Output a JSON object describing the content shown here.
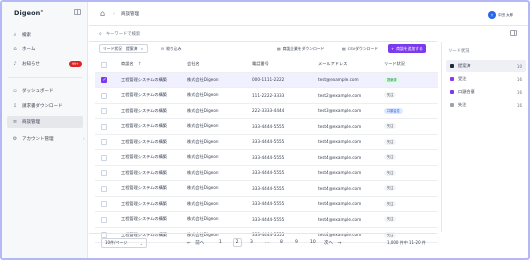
{
  "app": {
    "logo": "Digeon",
    "logo_mark": "®"
  },
  "sidebar": {
    "items": [
      {
        "icon": "search-icon",
        "label": "検索"
      },
      {
        "icon": "home-icon",
        "label": "ホーム"
      },
      {
        "icon": "bell-icon",
        "label": "お知らせ",
        "badge": "99+"
      },
      {
        "icon": "dashboard-icon",
        "label": "ダッシュボード"
      },
      {
        "icon": "download-icon",
        "label": "請求書ダウンロード"
      },
      {
        "icon": "list-icon",
        "label": "商談管理"
      },
      {
        "icon": "gear-icon",
        "label": "アカウント管理"
      }
    ]
  },
  "header": {
    "breadcrumb": "商談管理",
    "avatar_initials": "大",
    "username": "中田 太郎"
  },
  "search": {
    "placeholder": "キーワードで検索"
  },
  "toolbar": {
    "filter_chip_label": "リード状況",
    "filter_chip_value": "提案済",
    "filter_add_label": "絞り込み",
    "download_label": "商談企業をダウンロード",
    "csv_label": "CSVダウンロード",
    "add_label": "商談を追加する"
  },
  "table": {
    "columns": [
      "商談名",
      "会社名",
      "電話番号",
      "メールアドレス",
      "リード状況"
    ],
    "rows": [
      {
        "name": "工程管理システムの構築",
        "company": "株式会社Digeon",
        "phone": "000-1111-2222",
        "email": "test@example.com",
        "status": "提案済",
        "status_key": "proposed",
        "checked": true
      },
      {
        "name": "工程管理システムの構築",
        "company": "株式会社Digeon",
        "phone": "111-2222-3333",
        "email": "test2@example.com",
        "status": "失注",
        "status_key": "lost",
        "checked": false
      },
      {
        "name": "工程管理システムの構築",
        "company": "株式会社Digeon",
        "phone": "222-3333-4444",
        "email": "test3@example.com",
        "status": "口頭合意",
        "status_key": "verbal",
        "checked": false
      },
      {
        "name": "工程管理システムの構築",
        "company": "株式会社Digeon",
        "phone": "333-4444-5555",
        "email": "test4@example.com",
        "status": "失注",
        "status_key": "lost",
        "checked": false
      },
      {
        "name": "工程管理システムの構築",
        "company": "株式会社Digeon",
        "phone": "333-4444-5555",
        "email": "test4@example.com",
        "status": "失注",
        "status_key": "lost",
        "checked": false
      },
      {
        "name": "工程管理システムの構築",
        "company": "株式会社Digeon",
        "phone": "333-4444-5555",
        "email": "test4@example.com",
        "status": "失注",
        "status_key": "lost",
        "checked": false
      },
      {
        "name": "工程管理システムの構築",
        "company": "株式会社Digeon",
        "phone": "333-4444-5555",
        "email": "test4@example.com",
        "status": "失注",
        "status_key": "lost",
        "checked": false
      },
      {
        "name": "工程管理システムの構築",
        "company": "株式会社Digeon",
        "phone": "333-4444-5555",
        "email": "test4@example.com",
        "status": "失注",
        "status_key": "lost",
        "checked": false
      },
      {
        "name": "工程管理システムの構築",
        "company": "株式会社Digeon",
        "phone": "333-4444-5555",
        "email": "test4@example.com",
        "status": "失注",
        "status_key": "lost",
        "checked": false
      },
      {
        "name": "工程管理システムの構築",
        "company": "株式会社Digeon",
        "phone": "333-4444-5555",
        "email": "test4@example.com",
        "status": "失注",
        "status_key": "lost",
        "checked": false
      },
      {
        "name": "工程管理システムの構築",
        "company": "株式会社Digeon",
        "phone": "333-4444-5555",
        "email": "test4@example.com",
        "status": "失注",
        "status_key": "lost",
        "checked": false
      }
    ]
  },
  "status_colors": {
    "proposed": {
      "bg": "#dcfce7",
      "fg": "#15803d"
    },
    "lost": {
      "bg": "#f3f4f6",
      "fg": "#4b5563"
    },
    "verbal": {
      "bg": "#dbeafe",
      "fg": "#1d4ed8"
    }
  },
  "pagination": {
    "per_page": "10件/ページ",
    "prev": "前へ",
    "next": "次へ",
    "pages": [
      "1",
      "2",
      "3",
      "...",
      "8",
      "9",
      "10"
    ],
    "current": "2",
    "count": "1,000 件中 11-20 件"
  },
  "right_panel": {
    "title": "リード状況",
    "items": [
      {
        "label": "提案済",
        "count": "10",
        "color": "#1e293b"
      },
      {
        "label": "受注",
        "count": "16",
        "color": "#9333ea"
      },
      {
        "label": "口頭合意",
        "count": "16",
        "color": "#7c3aed"
      },
      {
        "label": "失注",
        "count": "16",
        "color": "#9ca3af"
      }
    ]
  }
}
